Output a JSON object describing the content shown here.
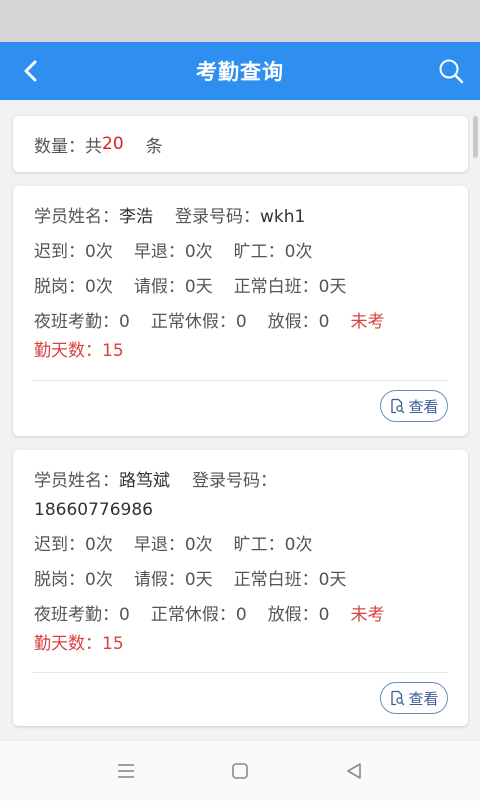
{
  "header": {
    "title": "考勤查询"
  },
  "summary": {
    "label": "数量：共",
    "count": "20",
    "unit": "条"
  },
  "view_label": "查看",
  "records": [
    {
      "name_label": "学员姓名：",
      "name": "李浩",
      "login_label": "登录号码：",
      "login": "wkh1",
      "late": "迟到：0次",
      "early": "早退：0次",
      "absent": "旷工：0次",
      "offpost": "脱岗：0次",
      "leave": "请假：0天",
      "dayshift": "正常白班：0天",
      "nightshift": "夜班考勤：0",
      "rest": "正常休假：0",
      "holiday": "放假：0",
      "unattended_a": "未考",
      "unattended_b": "勤天数：15"
    },
    {
      "name_label": "学员姓名：",
      "name": "路笃斌",
      "login_label": "登录号码：",
      "login": "18660776986",
      "late": "迟到：0次",
      "early": "早退：0次",
      "absent": "旷工：0次",
      "offpost": "脱岗：0次",
      "leave": "请假：0天",
      "dayshift": "正常白班：0天",
      "nightshift": "夜班考勤：0",
      "rest": "正常休假：0",
      "holiday": "放假：0",
      "unattended_a": "未考",
      "unattended_b": "勤天数：15"
    }
  ],
  "colors": {
    "primary": "#2e8ff0",
    "accent_red": "#d94040",
    "button_border": "#6b8cc2"
  },
  "icons": {
    "back": "chevron-left-icon",
    "search": "search-icon",
    "view": "document-search-icon"
  }
}
